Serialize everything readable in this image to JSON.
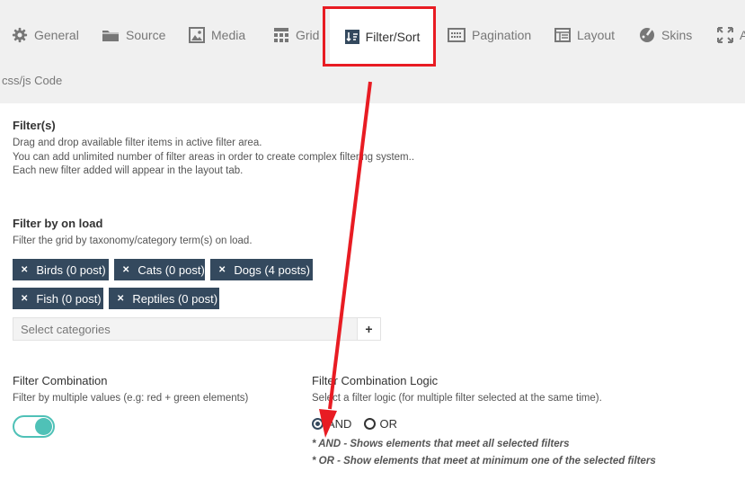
{
  "tabs": [
    {
      "label": "General",
      "icon": "gear-icon"
    },
    {
      "label": "Source",
      "icon": "folder-icon"
    },
    {
      "label": "Media",
      "icon": "image-icon"
    },
    {
      "label": "Grid",
      "icon": "grid-icon"
    },
    {
      "label": "Filter/Sort",
      "icon": "filter-sort-icon",
      "active": true
    },
    {
      "label": "Pagination",
      "icon": "pagination-icon"
    },
    {
      "label": "Layout",
      "icon": "layout-icon"
    },
    {
      "label": "Skins",
      "icon": "skins-icon"
    },
    {
      "label": "A",
      "icon": "expand-icon"
    }
  ],
  "subtab": {
    "label": "css/js Code"
  },
  "filters": {
    "title": "Filter(s)",
    "desc": [
      "Drag and drop available filter items in active filter area.",
      "You can add unlimited number of filter areas in order to create complex filtering system..",
      "Each new filter added will appear in the layout tab."
    ]
  },
  "filter_on_load": {
    "title": "Filter by on load",
    "desc": "Filter the grid by taxonomy/category term(s) on load.",
    "tags": [
      "Birds (0 post)",
      "Cats (0 post)",
      "Dogs (4 posts)",
      "Fish (0 post)",
      "Reptiles (0 post)"
    ],
    "select_placeholder": "Select categories",
    "add_label": "+"
  },
  "combination": {
    "title": "Filter Combination",
    "desc": "Filter by multiple values (e.g: red + green elements)",
    "enabled": true
  },
  "logic": {
    "title": "Filter Combination Logic",
    "desc": "Select a filter logic (for multiple filter selected at the same time).",
    "options": [
      "AND",
      "OR"
    ],
    "selected": "AND",
    "notes": [
      "* AND - Shows elements that meet all selected filters",
      "* OR - Show elements that meet at minimum one of the selected filters"
    ]
  },
  "colors": {
    "tag_bg": "#34495e",
    "toggle": "#4fc1b7",
    "highlight": "#e81c23"
  }
}
